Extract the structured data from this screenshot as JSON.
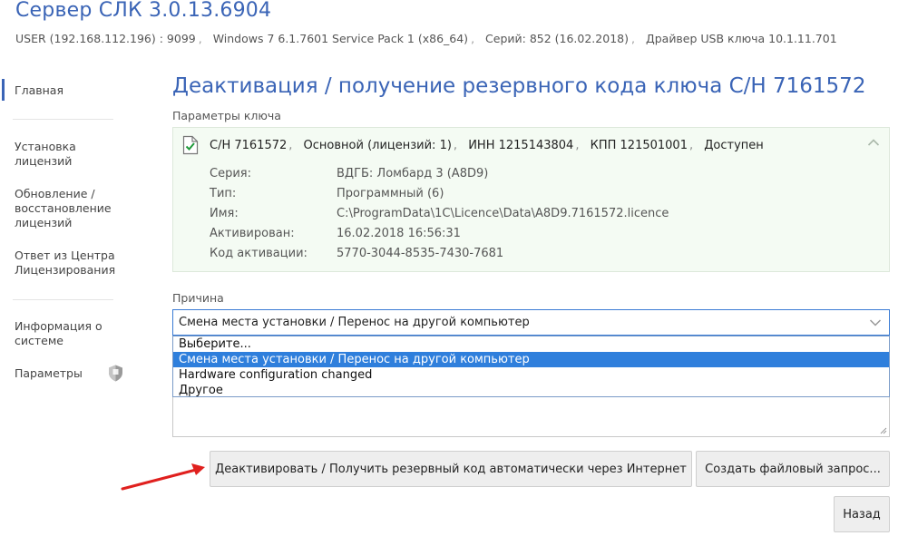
{
  "header": {
    "title": "Сервер СЛК 3.0.13.6904",
    "info": [
      "USER (192.168.112.196) : 9099",
      "Windows 7 6.1.7601 Service Pack 1 (x86_64)",
      "Серий: 852 (16.02.2018)",
      "Драйвер USB ключа 10.1.11.701"
    ],
    "info_separator": ","
  },
  "sidebar": {
    "items": [
      {
        "label": "Главная",
        "active": true
      },
      {
        "label": "Установка лицензий"
      },
      {
        "label": "Обновление / восстановление лицензий"
      },
      {
        "label": "Ответ из Центра Лицензирования"
      },
      {
        "label": "Информация о системе"
      },
      {
        "label": "Параметры",
        "icon": "shield-icon"
      }
    ],
    "accent_color": "#3a64b6"
  },
  "main": {
    "page_title": "Деактивация / получение резервного кода ключа С/Н 7161572",
    "key_section_label": "Параметры ключа",
    "key": {
      "status_icon": "check-document-icon",
      "summary": [
        "С/Н 7161572",
        "Основной (лицензий: 1)",
        "ИНН 1215143804",
        "КПП 121501001",
        "Доступен"
      ],
      "summary_separator": ",",
      "properties": [
        {
          "key": "Серия:",
          "value": "ВДГБ: Ломбард 3 (A8D9)"
        },
        {
          "key": "Тип:",
          "value": "Программный (6)"
        },
        {
          "key": "Имя:",
          "value": "C:\\ProgramData\\1C\\Licence\\Data\\A8D9.7161572.licence"
        },
        {
          "key": "Активирован:",
          "value": "16.02.2018 16:56:31"
        },
        {
          "key": "Код активации:",
          "value": "5770-3044-8535-7430-7681"
        }
      ],
      "panel_color": "#f4fbf3"
    },
    "reason_label": "Причина",
    "reason_select": {
      "value": "Смена места установки / Перенос на другой компьютер",
      "options": [
        "Выберите...",
        "Смена места установки / Перенос на другой компьютер",
        "Hardware configuration changed",
        "Другое"
      ],
      "selected_index": 1,
      "highlight_color": "#2f7fdc"
    },
    "buttons": {
      "deactivate": "Деактивировать / Получить резервный код автоматически через Интернет",
      "file_request": "Создать файловый запрос...",
      "back": "Назад"
    },
    "annotation_arrow_color": "#e0201e"
  }
}
